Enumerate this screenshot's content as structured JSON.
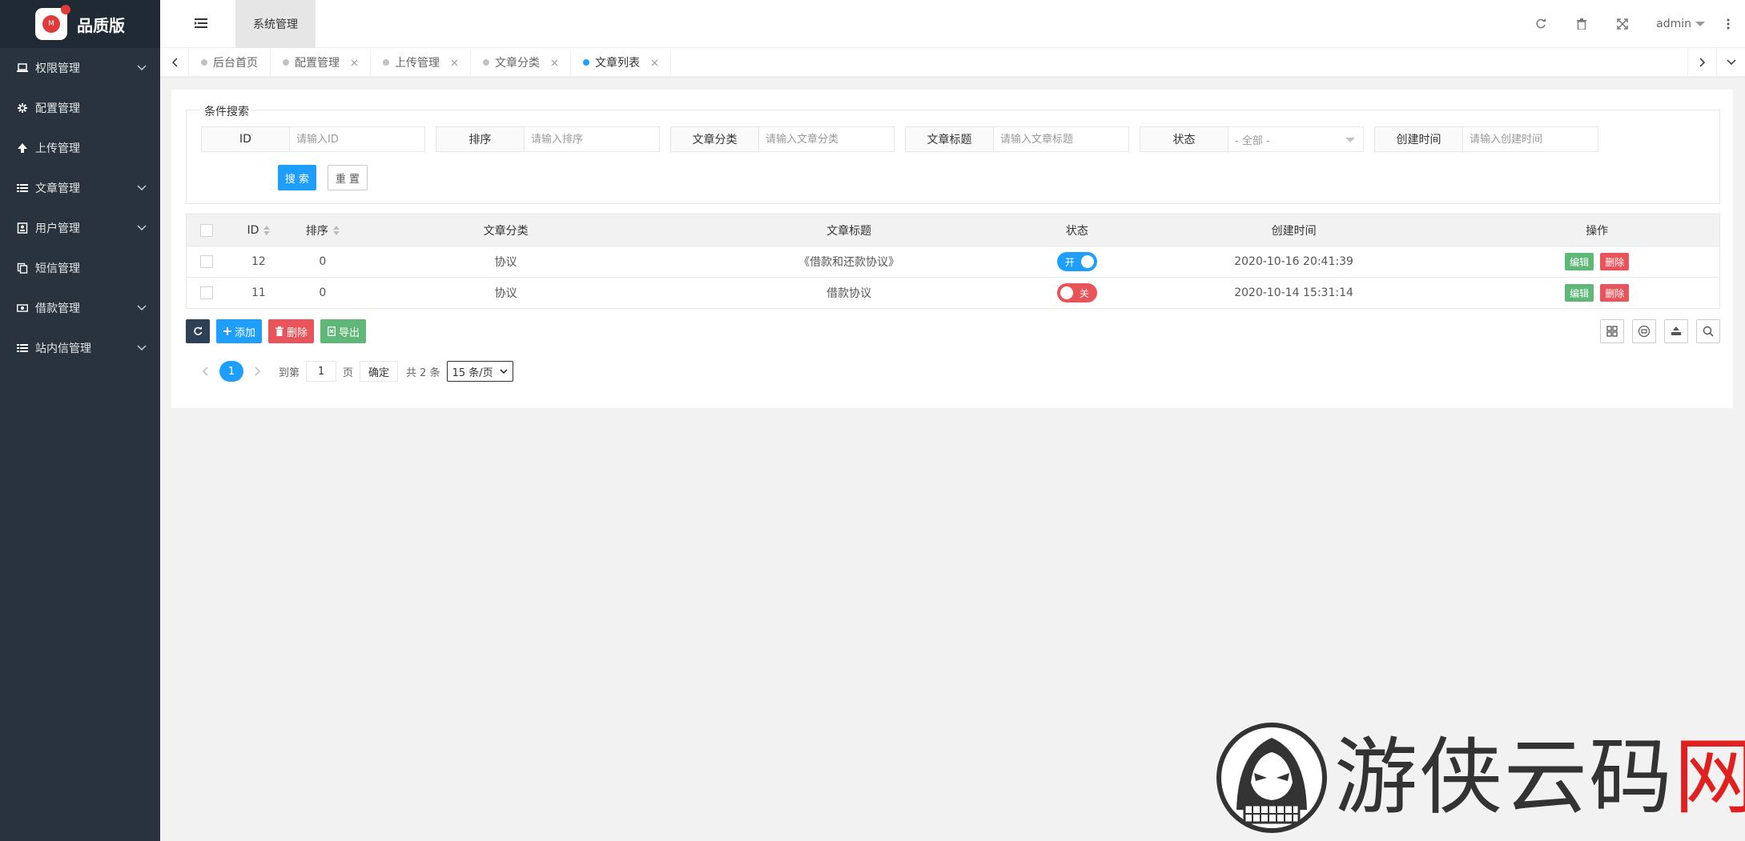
{
  "app": {
    "title": "品质版"
  },
  "sidebar": {
    "items": [
      {
        "label": "权限管理",
        "icon": "laptop-icon",
        "expandable": true
      },
      {
        "label": "配置管理",
        "icon": "gear-icon",
        "expandable": false
      },
      {
        "label": "上传管理",
        "icon": "upload-arrow-icon",
        "expandable": false
      },
      {
        "label": "文章管理",
        "icon": "list-icon",
        "expandable": true
      },
      {
        "label": "用户管理",
        "icon": "user-card-icon",
        "expandable": true
      },
      {
        "label": "短信管理",
        "icon": "copy-icon",
        "expandable": false
      },
      {
        "label": "借款管理",
        "icon": "money-icon",
        "expandable": true
      },
      {
        "label": "站内信管理",
        "icon": "list-icon",
        "expandable": true
      }
    ]
  },
  "header": {
    "tab": "系统管理",
    "user": "admin"
  },
  "tabs": [
    {
      "label": "后台首页",
      "closable": false,
      "active": false
    },
    {
      "label": "配置管理",
      "closable": true,
      "active": false
    },
    {
      "label": "上传管理",
      "closable": true,
      "active": false
    },
    {
      "label": "文章分类",
      "closable": true,
      "active": false
    },
    {
      "label": "文章列表",
      "closable": true,
      "active": true
    }
  ],
  "search": {
    "legend": "条件搜索",
    "fields": [
      {
        "label": "ID",
        "placeholder": "请输入ID"
      },
      {
        "label": "排序",
        "placeholder": "请输入排序"
      },
      {
        "label": "文章分类",
        "placeholder": "请输入文章分类"
      },
      {
        "label": "文章标题",
        "placeholder": "请输入文章标题"
      },
      {
        "label": "状态",
        "select_value": "- 全部 -"
      },
      {
        "label": "创建时间",
        "placeholder": "请输入创建时间"
      }
    ],
    "search_label": "搜 索",
    "reset_label": "重 置"
  },
  "table": {
    "columns": [
      "ID",
      "排序",
      "文章分类",
      "文章标题",
      "状态",
      "创建时间",
      "操作"
    ],
    "rows": [
      {
        "id": "12",
        "sort": "0",
        "category": "协议",
        "title": "《借款和还款协议》",
        "status_on": true,
        "status_label": "开",
        "created": "2020-10-16 20:41:39",
        "edit": "编辑",
        "delete": "删除"
      },
      {
        "id": "11",
        "sort": "0",
        "category": "协议",
        "title": "借款协议",
        "status_on": false,
        "status_label": "关",
        "created": "2020-10-14 15:31:14",
        "edit": "编辑",
        "delete": "删除"
      }
    ]
  },
  "toolbar": {
    "add_label": "添加",
    "delete_label": "删除",
    "export_label": "导出"
  },
  "pager": {
    "current": "1",
    "goto_label": "到第",
    "page_input": "1",
    "page_suffix": "页",
    "ok_label": "确定",
    "total": "共 2 条",
    "per_page": "15 条/页"
  },
  "watermark": {
    "text_main": "游侠云码",
    "text_red": "网"
  },
  "colors": {
    "sidebar_bg": "#28333e",
    "primary": "#1e9fff",
    "danger": "#e9545a",
    "success": "#5fb878",
    "dark": "#2f4056"
  }
}
